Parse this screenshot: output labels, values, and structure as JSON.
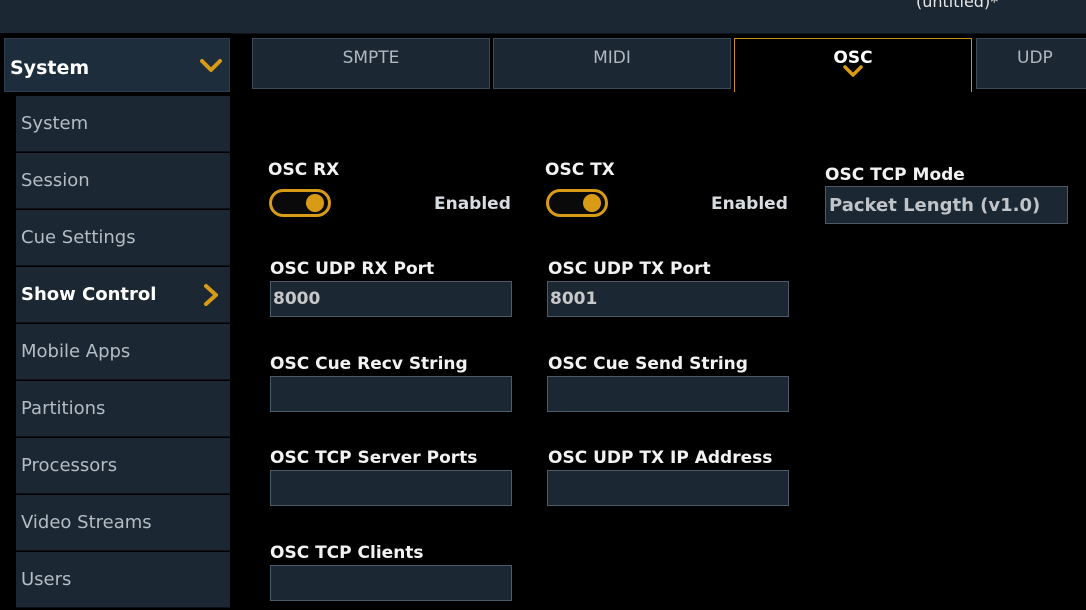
{
  "window": {
    "title": "(untitled)*"
  },
  "sidebar": {
    "header": "System",
    "items": [
      {
        "label": "System"
      },
      {
        "label": "Session"
      },
      {
        "label": "Cue Settings"
      },
      {
        "label": "Show Control"
      },
      {
        "label": "Mobile Apps"
      },
      {
        "label": "Partitions"
      },
      {
        "label": "Processors"
      },
      {
        "label": "Video Streams"
      },
      {
        "label": "Users"
      }
    ]
  },
  "tabs": [
    {
      "label": "SMPTE"
    },
    {
      "label": "MIDI"
    },
    {
      "label": "OSC"
    },
    {
      "label": "UDP"
    }
  ],
  "osc": {
    "rx": {
      "label": "OSC RX",
      "state": "Enabled"
    },
    "tx": {
      "label": "OSC TX",
      "state": "Enabled"
    },
    "tcp_mode": {
      "label": "OSC TCP Mode",
      "value": "Packet Length (v1.0)"
    },
    "udp_rx_port": {
      "label": "OSC UDP RX Port",
      "value": "8000"
    },
    "udp_tx_port": {
      "label": "OSC UDP TX Port",
      "value": "8001"
    },
    "cue_recv": {
      "label": "OSC Cue Recv String",
      "value": ""
    },
    "cue_send": {
      "label": "OSC Cue Send String",
      "value": ""
    },
    "tcp_server_ports": {
      "label": "OSC TCP Server Ports",
      "value": ""
    },
    "udp_tx_ip": {
      "label": "OSC UDP TX IP Address",
      "value": ""
    },
    "tcp_clients": {
      "label": "OSC TCP Clients",
      "value": ""
    }
  },
  "colors": {
    "accent": "#d89b16",
    "panel": "#1b2733",
    "background": "#000000"
  }
}
